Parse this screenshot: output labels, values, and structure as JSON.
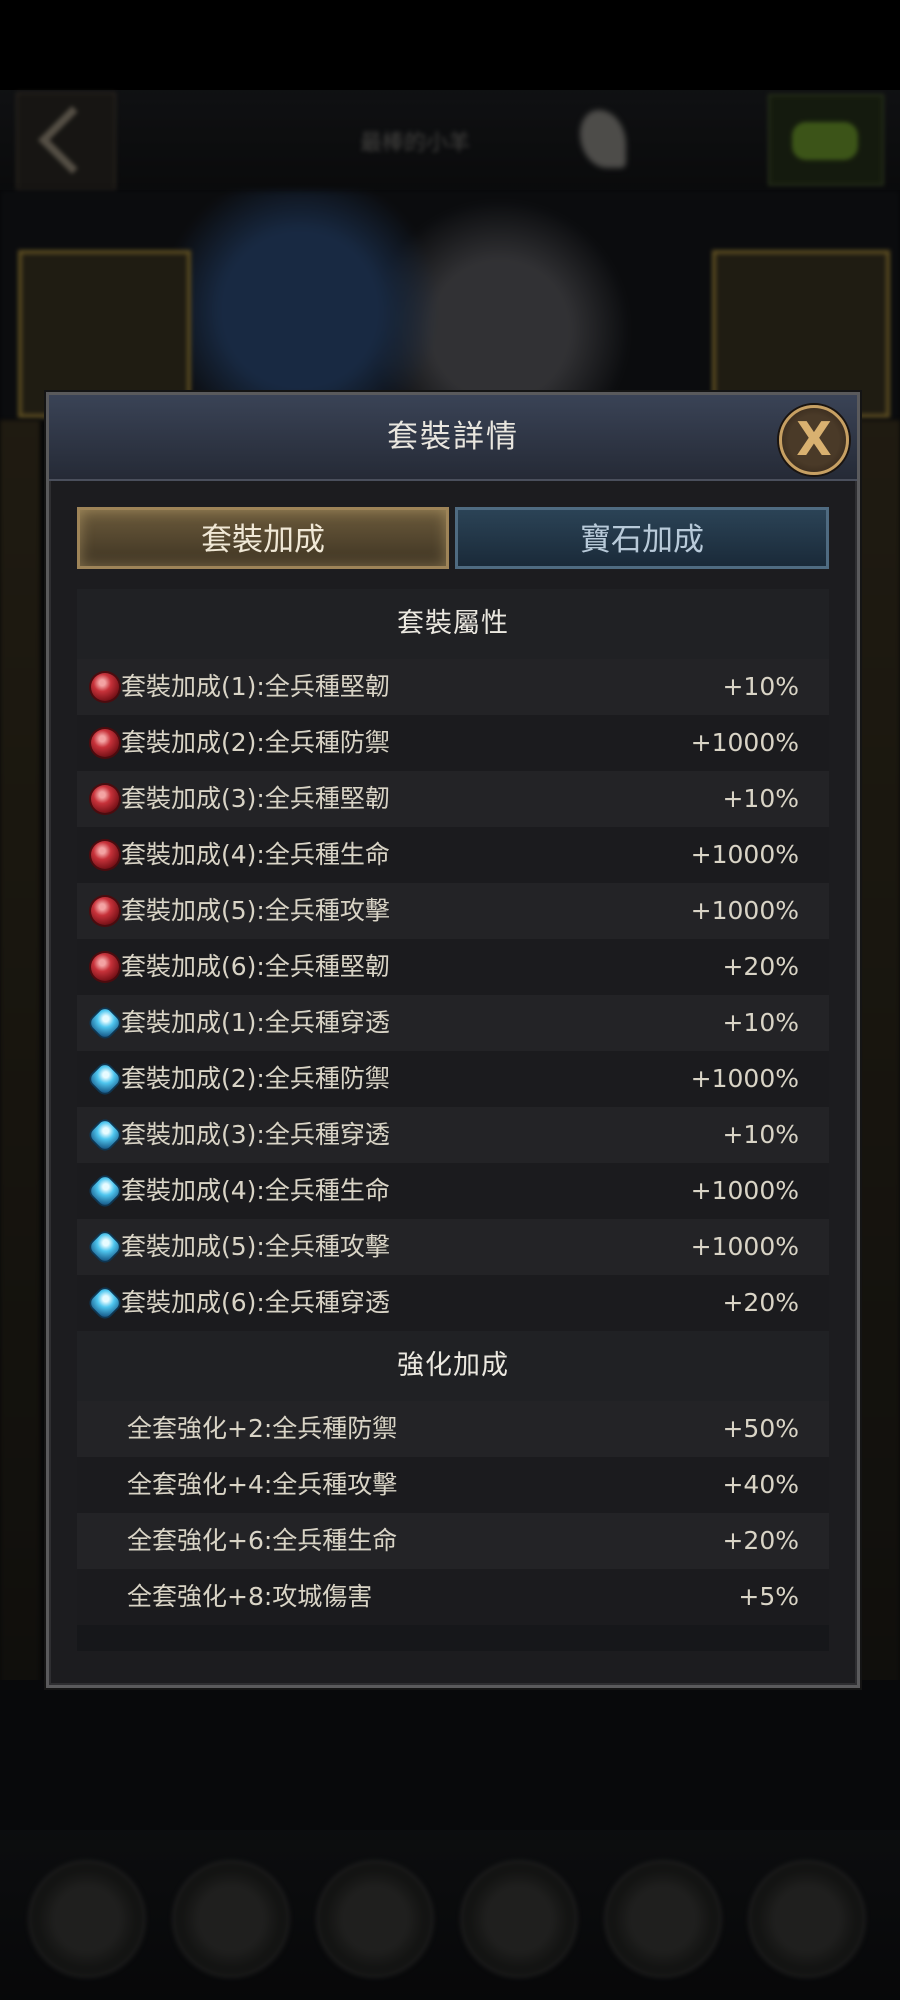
{
  "background": {
    "player_name": "最棒的小羊"
  },
  "modal": {
    "title": "套裝詳情",
    "close_glyph": "X",
    "tabs": [
      {
        "label": "套裝加成",
        "active": true
      },
      {
        "label": "寶石加成",
        "active": false
      }
    ],
    "set_section": {
      "title": "套裝屬性",
      "rows": [
        {
          "gem": "red-gem-icon",
          "label": "套裝加成(1):全兵種堅韌",
          "value": "+10%"
        },
        {
          "gem": "red-gem-icon",
          "label": "套裝加成(2):全兵種防禦",
          "value": "+1000%"
        },
        {
          "gem": "red-gem-icon",
          "label": "套裝加成(3):全兵種堅韌",
          "value": "+10%"
        },
        {
          "gem": "red-gem-icon",
          "label": "套裝加成(4):全兵種生命",
          "value": "+1000%"
        },
        {
          "gem": "red-gem-icon",
          "label": "套裝加成(5):全兵種攻擊",
          "value": "+1000%"
        },
        {
          "gem": "red-gem-icon",
          "label": "套裝加成(6):全兵種堅韌",
          "value": "+20%"
        },
        {
          "gem": "blue-gem-icon",
          "label": "套裝加成(1):全兵種穿透",
          "value": "+10%"
        },
        {
          "gem": "blue-gem-icon",
          "label": "套裝加成(2):全兵種防禦",
          "value": "+1000%"
        },
        {
          "gem": "blue-gem-icon",
          "label": "套裝加成(3):全兵種穿透",
          "value": "+10%"
        },
        {
          "gem": "blue-gem-icon",
          "label": "套裝加成(4):全兵種生命",
          "value": "+1000%"
        },
        {
          "gem": "blue-gem-icon",
          "label": "套裝加成(5):全兵種攻擊",
          "value": "+1000%"
        },
        {
          "gem": "blue-gem-icon",
          "label": "套裝加成(6):全兵種穿透",
          "value": "+20%"
        }
      ]
    },
    "enhance_section": {
      "title": "強化加成",
      "rows": [
        {
          "label": "全套強化+2:全兵種防禦",
          "value": "+50%"
        },
        {
          "label": "全套強化+4:全兵種攻擊",
          "value": "+40%"
        },
        {
          "label": "全套強化+6:全兵種生命",
          "value": "+20%"
        },
        {
          "label": "全套強化+8:攻城傷害",
          "value": "+5%"
        }
      ]
    }
  }
}
